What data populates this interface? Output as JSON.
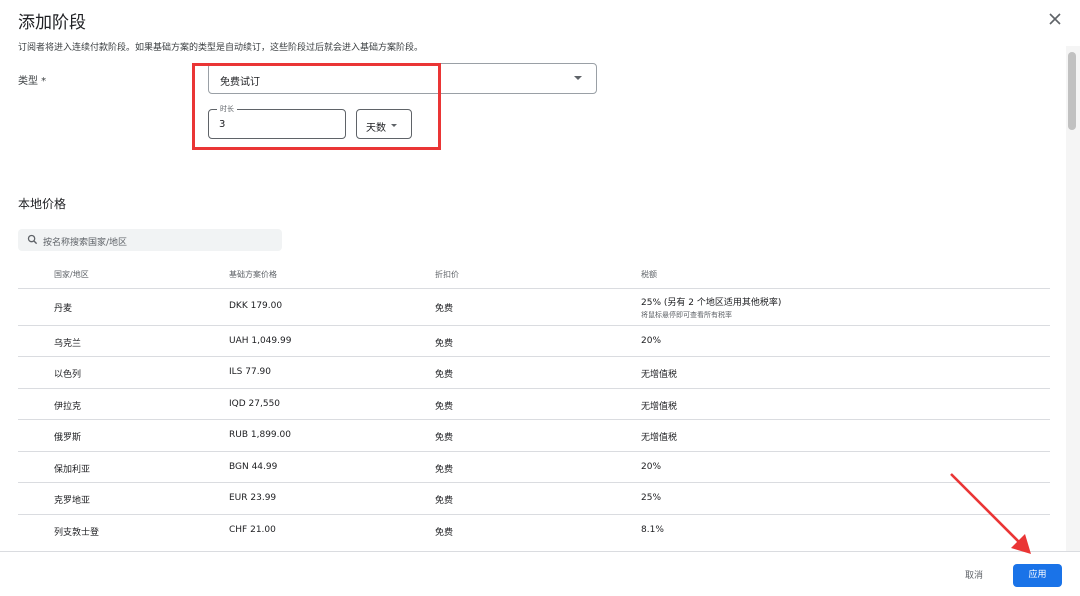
{
  "dialog": {
    "title": "添加阶段",
    "subtitle": "订阅者将进入连续付款阶段。如果基础方案的类型是自动续订，这些阶段过后就会进入基础方案阶段。",
    "type_label": "类型 *",
    "type_value": "免费试订",
    "duration_label": "时长",
    "duration_value": "3",
    "duration_unit": "天数"
  },
  "local_prices": {
    "title": "本地价格",
    "search_placeholder": "按名称搜索国家/地区",
    "headers": [
      "国家/地区",
      "基础方案价格",
      "折扣价",
      "税额"
    ],
    "rows": [
      {
        "country": "丹麦",
        "price": "DKK 179.00",
        "discount": "免费",
        "tax": "25% (另有 2 个地区适用其他税率)",
        "note": "将鼠标悬停即可查看所有税率"
      },
      {
        "country": "乌克兰",
        "price": "UAH 1,049.99",
        "discount": "免费",
        "tax": "20%"
      },
      {
        "country": "以色列",
        "price": "ILS 77.90",
        "discount": "免费",
        "tax": "无增值税"
      },
      {
        "country": "伊拉克",
        "price": "IQD 27,550",
        "discount": "免费",
        "tax": "无增值税"
      },
      {
        "country": "俄罗斯",
        "price": "RUB 1,899.00",
        "discount": "免费",
        "tax": "无增值税"
      },
      {
        "country": "保加利亚",
        "price": "BGN 44.99",
        "discount": "免费",
        "tax": "20%"
      },
      {
        "country": "克罗地亚",
        "price": "EUR 23.99",
        "discount": "免费",
        "tax": "25%"
      },
      {
        "country": "列支敦士登",
        "price": "CHF 21.00",
        "discount": "免费",
        "tax": "8.1%"
      }
    ]
  },
  "footer": {
    "cancel_label": "取消",
    "apply_label": "应用"
  },
  "colors": {
    "primary": "#1a73e8",
    "annotation_red": "#ea3535"
  },
  "icons": {
    "close": "close-icon",
    "search": "search-icon",
    "dropdown": "chevron-down-icon"
  }
}
